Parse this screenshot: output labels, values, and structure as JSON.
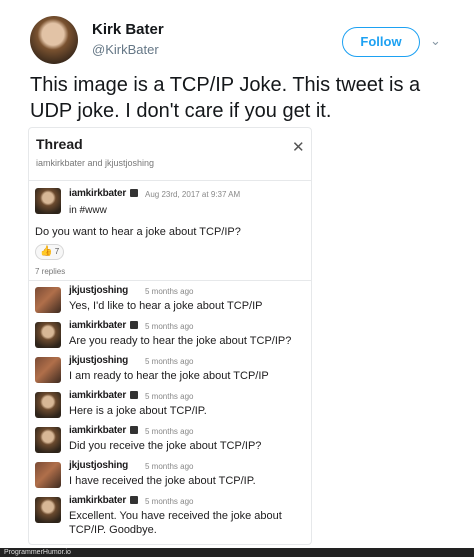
{
  "tweet": {
    "display_name": "Kirk Bater",
    "handle": "@KirkBater",
    "follow_label": "Follow",
    "text_line1": "This image is a TCP/IP Joke.  This tweet is a",
    "text_line2": "UDP joke.  I don't care if you get it."
  },
  "thread": {
    "title": "Thread",
    "subtitle": "iamkirkbater and jkjustjoshing",
    "parent": {
      "author": "iamkirkbater",
      "timestamp": "Aug 23rd, 2017 at 9:37 AM",
      "channel": "in #www",
      "text": "Do you want to hear a joke about TCP/IP?",
      "reaction_count": "7"
    },
    "reply_count": "7 replies",
    "replies": [
      {
        "author": "jkjustjoshing",
        "time": "5 months ago",
        "text": "Yes, I'd like to hear a joke about TCP/IP"
      },
      {
        "author": "iamkirkbater",
        "time": "5 months ago",
        "text": "Are you ready to hear the joke about TCP/IP?"
      },
      {
        "author": "jkjustjoshing",
        "time": "5 months ago",
        "text": "I am ready to hear the joke about TCP/IP"
      },
      {
        "author": "iamkirkbater",
        "time": "5 months ago",
        "text": "Here is a joke about TCP/IP."
      },
      {
        "author": "iamkirkbater",
        "time": "5 months ago",
        "text": "Did you receive the joke about TCP/IP?"
      },
      {
        "author": "jkjustjoshing",
        "time": "5 months ago",
        "text": "I have received the joke about TCP/IP."
      },
      {
        "author": "iamkirkbater",
        "time": "5 months ago",
        "text": "Excellent.  You have received the joke about TCP/IP.  Goodbye."
      }
    ]
  },
  "watermark": "ProgrammerHumor.io",
  "colors": {
    "accent": "#1da1f2",
    "text": "#14171a",
    "muted": "#657786"
  }
}
